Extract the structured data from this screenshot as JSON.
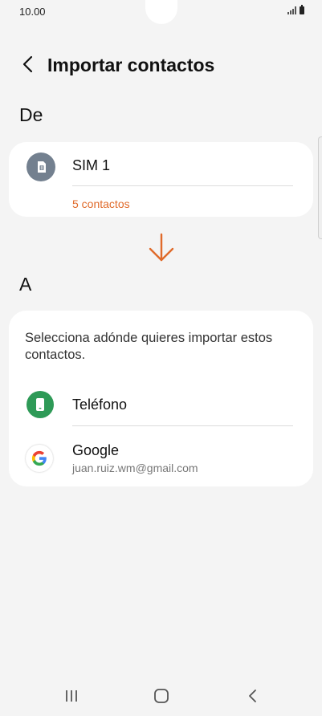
{
  "status_bar": {
    "time": "10.00"
  },
  "header": {
    "back_icon": "chevron-left-icon",
    "title": "Importar contactos"
  },
  "from_section": {
    "label": "De",
    "source": {
      "icon": "sim-card-icon",
      "name": "SIM 1",
      "count": "5 contactos"
    }
  },
  "to_section": {
    "label": "A",
    "description": "Selecciona adónde quieres importar estos contactos.",
    "options": [
      {
        "icon": "phone-icon",
        "label": "Teléfono",
        "sublabel": ""
      },
      {
        "icon": "google-icon",
        "label": "Google",
        "sublabel": "juan.ruiz.wm@gmail.com"
      }
    ]
  },
  "colors": {
    "accent": "#e06a2a",
    "phone_icon_bg": "#2e9a57",
    "sim_icon_bg": "#73808f",
    "background": "#f4f4f4",
    "card": "#ffffff"
  },
  "nav_bar": {
    "icons": [
      "recents-icon",
      "home-icon",
      "back-icon"
    ]
  }
}
